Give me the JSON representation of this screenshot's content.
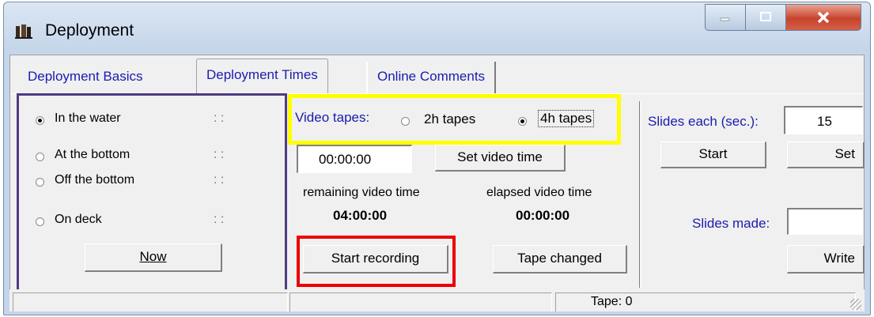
{
  "window": {
    "title": "Deployment"
  },
  "tabs": [
    "Deployment Basics",
    "Deployment Times",
    "Online Comments"
  ],
  "times": {
    "options": [
      {
        "label": "In the water",
        "time": ": :",
        "selected": true
      },
      {
        "label": "At the bottom",
        "time": ": :",
        "selected": false
      },
      {
        "label": "Off the bottom",
        "time": ": :",
        "selected": false
      },
      {
        "label": "On deck",
        "time": ": :",
        "selected": false
      }
    ],
    "now_button": "Now"
  },
  "video": {
    "tapes_label": "Video tapes:",
    "option_2h": "2h tapes",
    "option_4h": "4h tapes",
    "selected": "4h tapes",
    "time_value": "00:00:00",
    "set_button": "Set video time",
    "remaining_label": "remaining video time",
    "remaining_value": "04:00:00",
    "elapsed_label": "elapsed video time",
    "elapsed_value": "00:00:00",
    "start_button": "Start recording",
    "tape_changed_button": "Tape changed"
  },
  "slides": {
    "each_label": "Slides each (sec.):",
    "each_value": "15",
    "start_button": "Start",
    "set_button": "Set",
    "made_label": "Slides made:",
    "made_value": "",
    "write_button": "Write"
  },
  "status": {
    "pane1": "",
    "pane2": "",
    "tape": "Tape: 0"
  },
  "colors": {
    "highlight_purple": "#4e3b84",
    "highlight_yellow": "#ffff00",
    "highlight_red": "#ee0000",
    "tab_text": "#1b1bb0"
  }
}
